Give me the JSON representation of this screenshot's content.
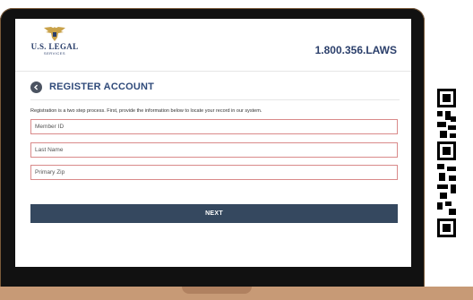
{
  "header": {
    "logo_name": "U.S. LEGAL",
    "logo_sub": "SERVICES",
    "phone": "1.800.356.LAWS"
  },
  "section": {
    "title": "REGISTER ACCOUNT",
    "intro": "Registration is a two step process. First, provide the information below to locate your record in our system."
  },
  "form": {
    "member_id_placeholder": "Member ID",
    "last_name_placeholder": "Last Name",
    "zip_placeholder": "Primary Zip",
    "next_label": "NEXT"
  },
  "colors": {
    "brand_navy": "#2b3f6b",
    "button": "#35485f",
    "field_border": "#d98a8a",
    "laptop_base": "#c79a76"
  }
}
